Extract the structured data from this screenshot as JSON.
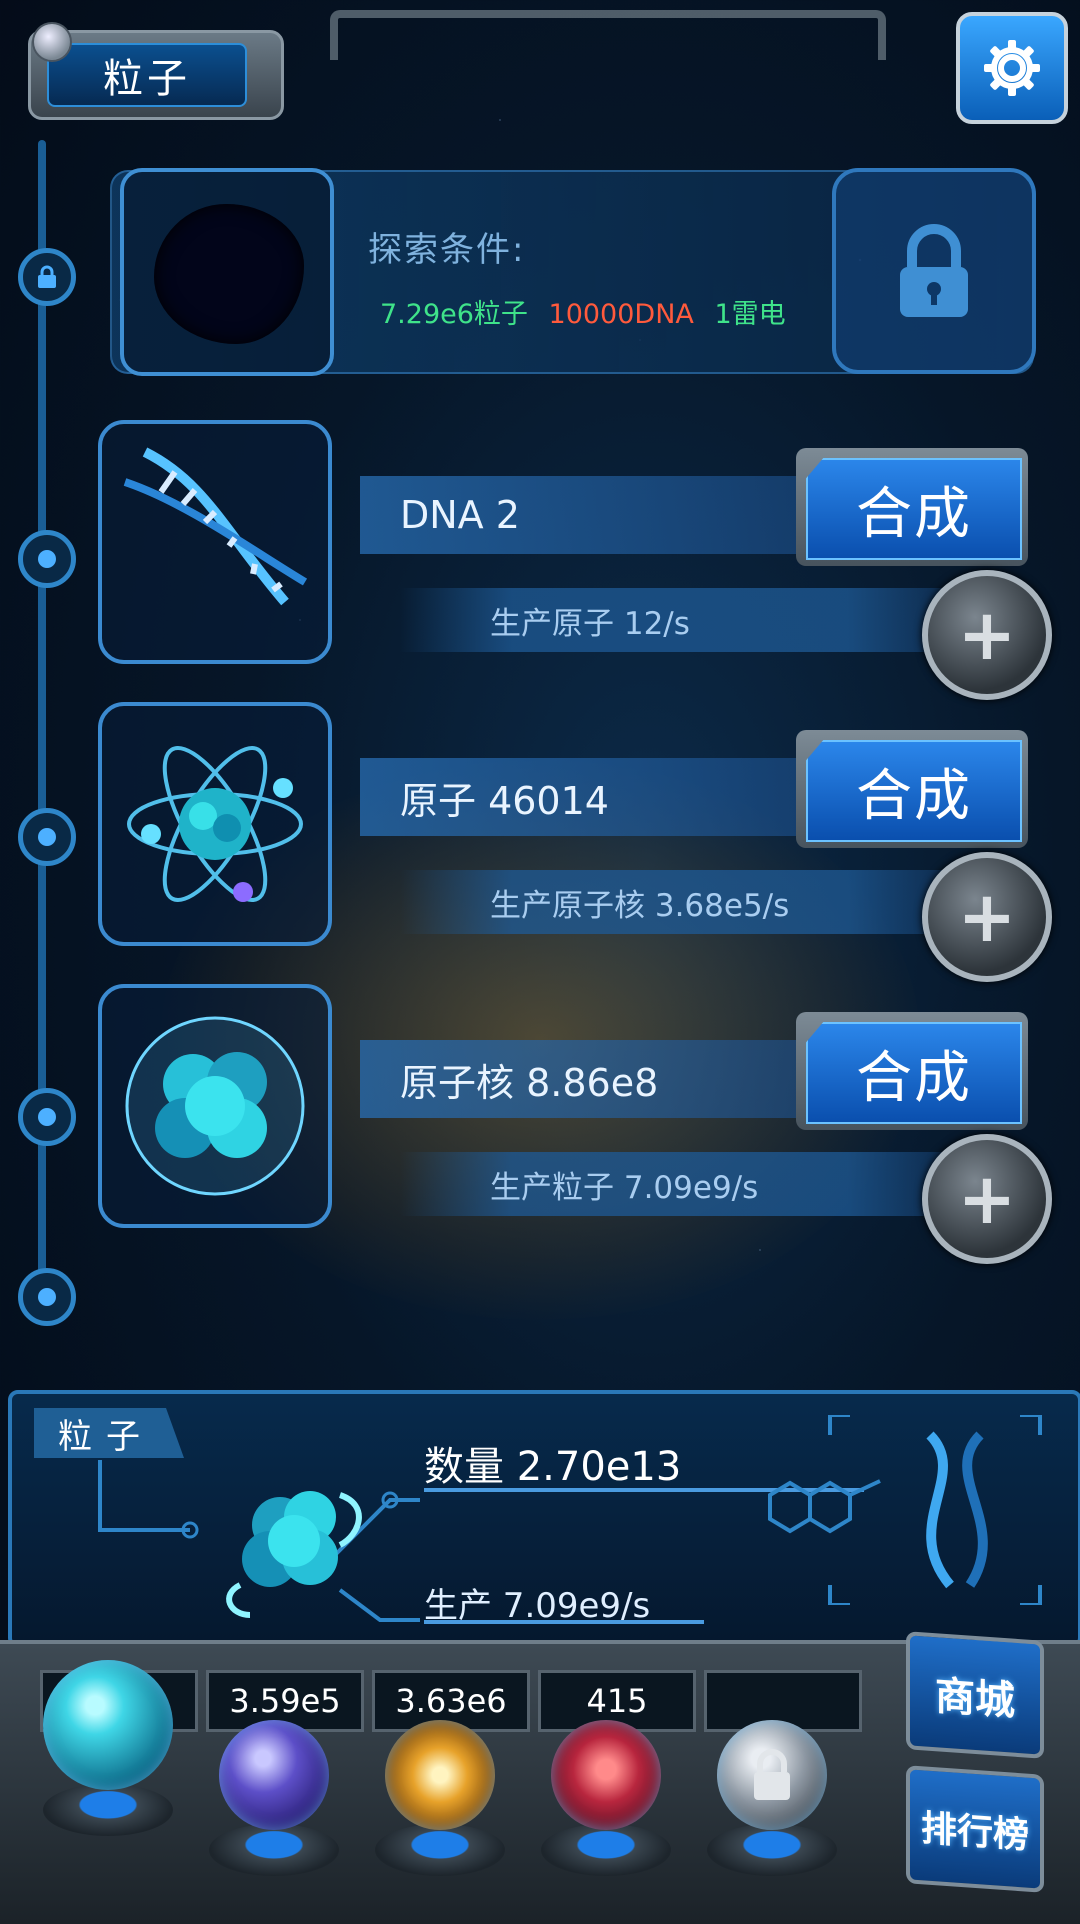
{
  "header": {
    "title": "粒子",
    "settings_icon": "gear-icon"
  },
  "explore": {
    "label": "探索条件:",
    "requirements": [
      {
        "text": "7.29e6粒子",
        "color": "#3fe38a"
      },
      {
        "text": "10000DNA",
        "color": "#ff5a3c"
      },
      {
        "text": "1雷电",
        "color": "#3fe38a"
      }
    ],
    "lock_icon": "lock-icon"
  },
  "items": [
    {
      "name": "DNA 2",
      "production": "生产原子 12/s",
      "synth_label": "合成",
      "icon": "dna-icon"
    },
    {
      "name": "原子 46014",
      "production": "生产原子核 3.68e5/s",
      "synth_label": "合成",
      "icon": "atom-icon"
    },
    {
      "name": "原子核 8.86e8",
      "production": "生产粒子 7.09e9/s",
      "synth_label": "合成",
      "icon": "nucleus-icon"
    }
  ],
  "info": {
    "tag": "粒子",
    "quantity": "数量 2.70e13",
    "production": "生产 7.09e9/s"
  },
  "dock": {
    "counts": [
      "3.59e5",
      "3.63e6",
      "415",
      ""
    ],
    "orbs": [
      {
        "name": "particle-orb-icon",
        "selected": true
      },
      {
        "name": "lightning-orb-icon"
      },
      {
        "name": "nebula-orb-icon"
      },
      {
        "name": "brain-orb-icon"
      },
      {
        "name": "locked-orb-icon"
      }
    ],
    "shop_label": "商城",
    "rank_label": "排行榜"
  },
  "colors": {
    "accent": "#2b86ea",
    "frame": "#3b8ad0",
    "green": "#3fe38a",
    "red": "#ff5a3c"
  }
}
